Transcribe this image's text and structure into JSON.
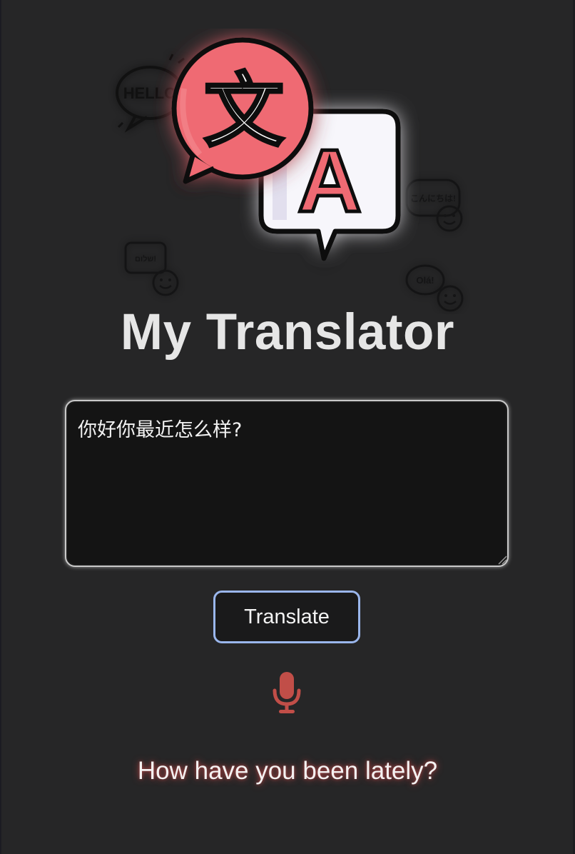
{
  "app": {
    "title": "My Translator"
  },
  "logo": {
    "icon": "translate-logo-icon",
    "main_glyph": "文",
    "second_glyph": "A",
    "accent_color": "#ef6b73",
    "bubbles": {
      "hello": "HELLO",
      "japanese": "こんにちは!",
      "hebrew": "שלום!",
      "portuguese": "Olá!"
    }
  },
  "input": {
    "value": "你好你最近怎么样?",
    "placeholder": ""
  },
  "translate_button": {
    "label": "Translate"
  },
  "mic": {
    "icon": "microphone-icon",
    "color": "#c14e48"
  },
  "result": {
    "text": "How have you been lately?"
  }
}
